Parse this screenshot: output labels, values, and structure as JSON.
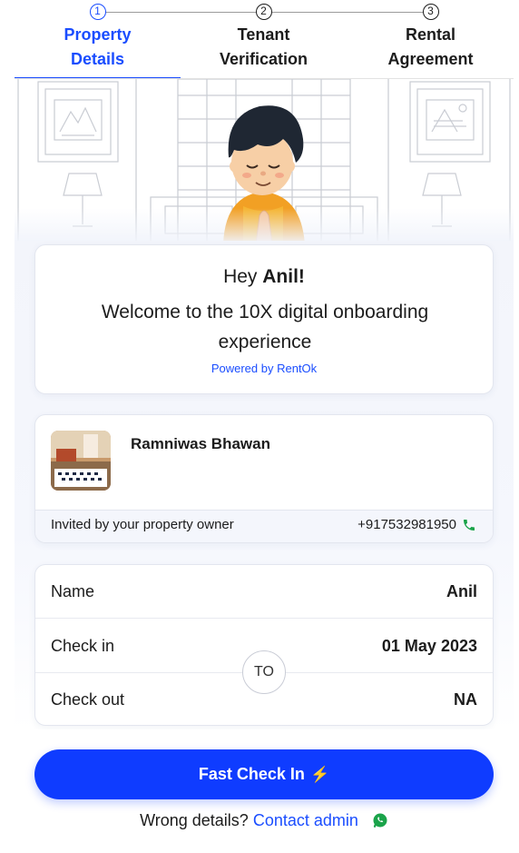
{
  "stepper": {
    "steps": [
      {
        "number": "1",
        "label": "Property Details",
        "active": true
      },
      {
        "number": "2",
        "label": "Tenant Verification",
        "active": false
      },
      {
        "number": "3",
        "label": "Rental Agreement",
        "active": false
      }
    ]
  },
  "welcome": {
    "greeting": "Hey",
    "name": "Anil!",
    "message": "Welcome to the 10X digital onboarding experience",
    "powered_by": "Powered by RentOk"
  },
  "property": {
    "name": "Ramniwas Bhawan",
    "invited_text": "Invited by your property owner",
    "phone": "+917532981950"
  },
  "details": {
    "rows": [
      {
        "key": "Name",
        "value": "Anil"
      },
      {
        "key": "Check in",
        "value": "01 May 2023"
      },
      {
        "key": "Check out",
        "value": "NA"
      }
    ],
    "separator": "TO"
  },
  "footer": {
    "cta_label": "Fast Check In",
    "cta_icon": "⚡",
    "wrong_text": "Wrong details?",
    "contact_link": "Contact admin"
  },
  "colors": {
    "accent": "#1a4dff",
    "cta": "#0f3cff",
    "whatsapp": "#1aa34a",
    "phone": "#1aa34a"
  }
}
